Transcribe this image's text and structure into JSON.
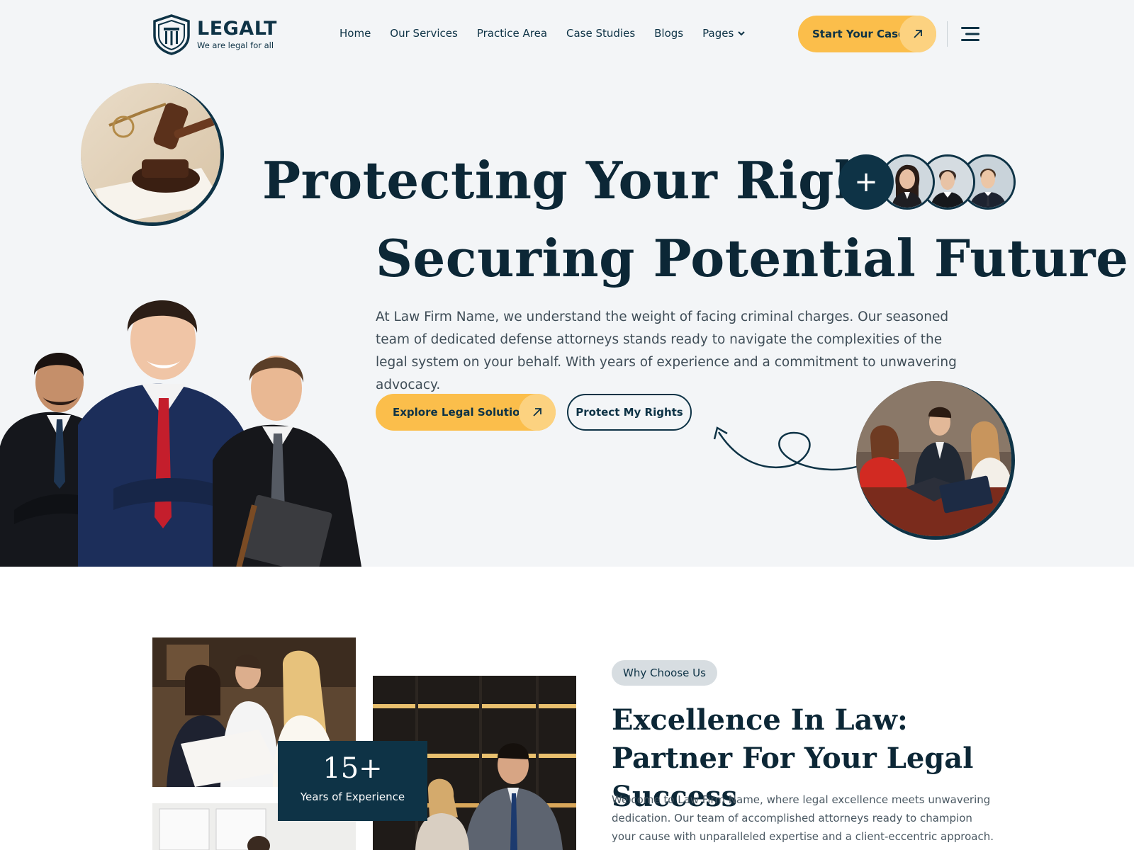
{
  "brand": {
    "name": "LEGALT",
    "tagline": "We are legal for all"
  },
  "nav": {
    "items": [
      "Home",
      "Our Services",
      "Practice Area",
      "Case Studies",
      "Blogs",
      "Pages"
    ]
  },
  "header": {
    "cta_label": "Start Your Case"
  },
  "hero": {
    "headline_line1": "Protecting Your Rights",
    "headline_line2": "Securing Potential Future",
    "paragraph": "At Law Firm Name, we understand the weight of facing criminal charges. Our seasoned team of dedicated defense attorneys stands ready to navigate the complexities of the legal system on your behalf. With years of experience and a commitment to unwavering advocacy.",
    "primary_btn": "Explore Legal Solutions",
    "secondary_btn": "Protect My Rights",
    "plus_symbol": "+"
  },
  "about": {
    "experience_number": "15+",
    "experience_label": "Years of Experience",
    "badge": "Why Choose Us",
    "heading": "Excellence In Law: Partner For Your Legal Success",
    "paragraph": "Welcome to Law Firm Name, where legal excellence meets unwavering dedication. Our team of accomplished attorneys ready to champion your cause with unparalleled expertise and a client-eccentric approach."
  },
  "colors": {
    "navy": "#0e3346",
    "accent": "#fbbe4b",
    "hero_bg": "#f3f5f7"
  },
  "icons": [
    "shield-logo-icon",
    "chevron-down-icon",
    "arrow-up-right-icon",
    "hamburger-menu-icon",
    "plus-icon"
  ]
}
